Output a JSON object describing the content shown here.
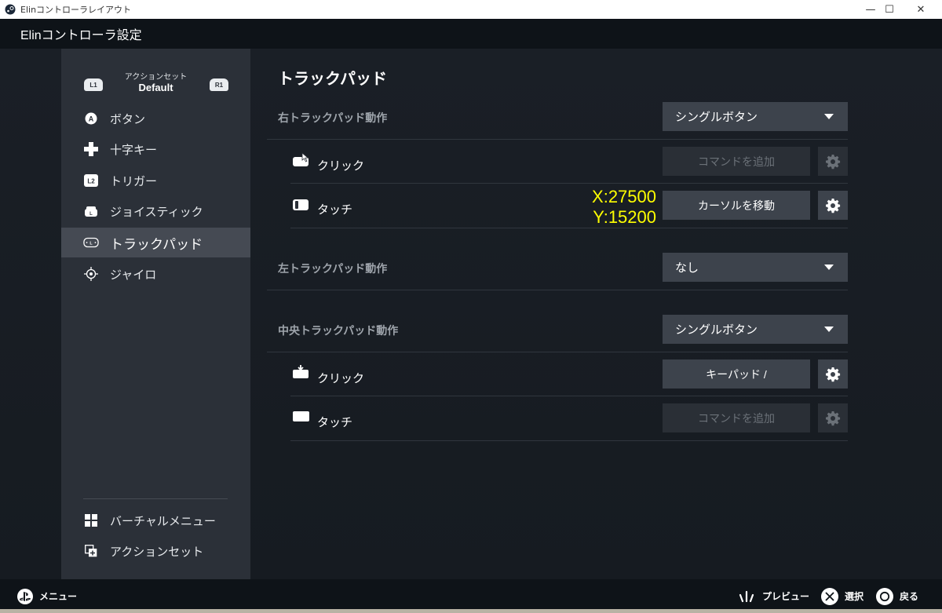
{
  "window": {
    "title": "Elinコントローラレイアウト",
    "minimize": "—",
    "maximize": "☐",
    "close": "✕"
  },
  "header": {
    "title": "Elinコントローラ設定"
  },
  "sidebar": {
    "action_set": {
      "label": "アクションセット",
      "value": "Default",
      "left_shoulder": "L1",
      "right_shoulder": "R1"
    },
    "items": [
      {
        "label": "ボタン",
        "icon": "a-button-icon"
      },
      {
        "label": "十字キー",
        "icon": "dpad-icon"
      },
      {
        "label": "トリガー",
        "icon": "l2-trigger-icon"
      },
      {
        "label": "ジョイスティック",
        "icon": "joystick-icon"
      },
      {
        "label": "トラックパッド",
        "icon": "trackpad-icon",
        "active": true
      },
      {
        "label": "ジャイロ",
        "icon": "gyro-icon"
      }
    ],
    "bottom_items": [
      {
        "label": "バーチャルメニュー",
        "icon": "grid-icon"
      },
      {
        "label": "アクションセット",
        "icon": "action-set-icon"
      }
    ]
  },
  "content": {
    "title": "トラックパッド",
    "right_trackpad": {
      "label": "右トラックパッド動作",
      "mode": "シングルボタン",
      "click": {
        "label": "クリック",
        "command": "コマンドを追加"
      },
      "touch": {
        "label": "タッチ",
        "command": "カーソルを移動"
      }
    },
    "coords": {
      "x": "X:27500",
      "y": "Y:15200"
    },
    "left_trackpad": {
      "label": "左トラックパッド動作",
      "mode": "なし"
    },
    "center_trackpad": {
      "label": "中央トラックパッド動作",
      "mode": "シングルボタン",
      "click": {
        "label": "クリック",
        "command": "キーパッド /"
      },
      "touch": {
        "label": "タッチ",
        "command": "コマンドを追加"
      }
    }
  },
  "footer": {
    "menu": "メニュー",
    "preview": "プレビュー",
    "select": "選択",
    "back": "戻る"
  },
  "colors": {
    "sidebar_bg": "#2b3038",
    "active_item": "#454a53",
    "button_bg": "#3d434c",
    "coord_text": "#ffff00"
  }
}
